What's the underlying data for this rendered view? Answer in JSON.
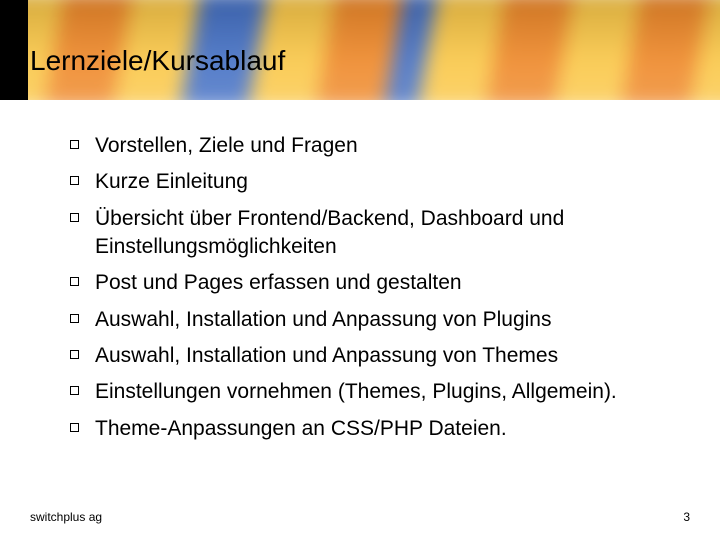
{
  "header": {
    "title": "Lernziele/Kursablauf"
  },
  "items": [
    "Vorstellen, Ziele und Fragen",
    "Kurze Einleitung",
    "Übersicht über Frontend/Backend, Dashboard und Einstellungsmöglichkeiten",
    "Post und Pages erfassen und gestalten",
    "Auswahl, Installation und Anpassung von Plugins",
    "Auswahl, Installation und Anpassung von Themes",
    "Einstellungen vornehmen (Themes, Plugins, Allgemein).",
    "Theme-Anpassungen an CSS/PHP Dateien."
  ],
  "footer": {
    "org": "switchplus ag",
    "page": "3"
  }
}
